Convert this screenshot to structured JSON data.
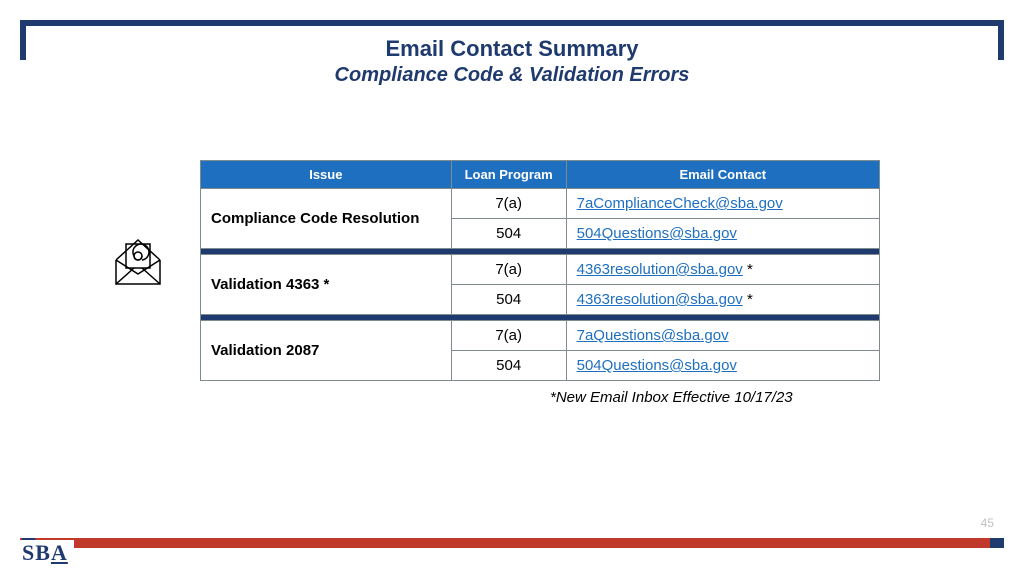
{
  "title": "Email Contact Summary",
  "subtitle": "Compliance Code & Validation Errors",
  "headers": {
    "issue": "Issue",
    "program": "Loan Program",
    "email": "Email Contact"
  },
  "groups": [
    {
      "issue": "Compliance Code Resolution",
      "rows": [
        {
          "program": "7(a)",
          "email": "7aComplianceCheck@sba.gov",
          "star": ""
        },
        {
          "program": "504",
          "email": "504Questions@sba.gov",
          "star": ""
        }
      ]
    },
    {
      "issue": "Validation 4363 *",
      "rows": [
        {
          "program": "7(a)",
          "email": "4363resolution@sba.gov",
          "star": " *"
        },
        {
          "program": "504",
          "email": "4363resolution@sba.gov",
          "star": " *"
        }
      ]
    },
    {
      "issue": "Validation 2087",
      "rows": [
        {
          "program": "7(a)",
          "email": "7aQuestions@sba.gov",
          "star": ""
        },
        {
          "program": "504",
          "email": "504Questions@sba.gov",
          "star": ""
        }
      ]
    }
  ],
  "footnote": "*New Email Inbox Effective 10/17/23",
  "page_number": "45",
  "logo_text": "SBA"
}
